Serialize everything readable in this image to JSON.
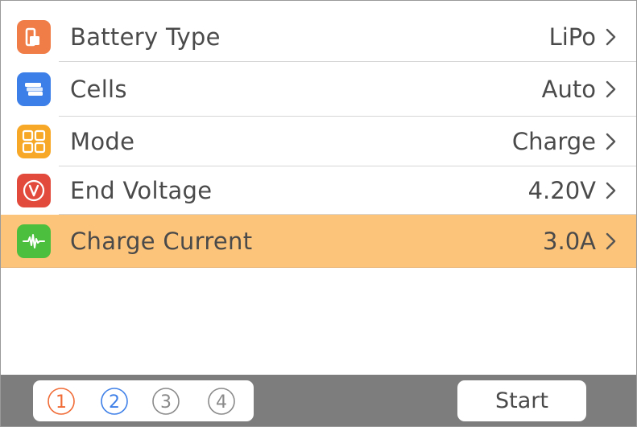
{
  "settings": [
    {
      "label": "Battery Type",
      "value": "LiPo",
      "icon": "battery-icon",
      "icon_color": "#f07c47"
    },
    {
      "label": "Cells",
      "value": "Auto",
      "icon": "cells-icon",
      "icon_color": "#3c7fe8"
    },
    {
      "label": "Mode",
      "value": "Charge",
      "icon": "mode-grid-icon",
      "icon_color": "#f7a826"
    },
    {
      "label": "End Voltage",
      "value": "4.20V",
      "icon": "voltage-icon",
      "icon_color": "#e24a3c"
    },
    {
      "label": "Charge Current",
      "value": "3.0A",
      "icon": "waveform-icon",
      "icon_color": "#4cbf3f",
      "selected": true
    }
  ],
  "highlight_color": "#fcc37a",
  "pager": {
    "pages": [
      "1",
      "2",
      "3",
      "4"
    ],
    "colors": [
      "#f06b36",
      "#3f80e8",
      "#8a8a8a",
      "#8a8a8a"
    ]
  },
  "start_label": "Start"
}
